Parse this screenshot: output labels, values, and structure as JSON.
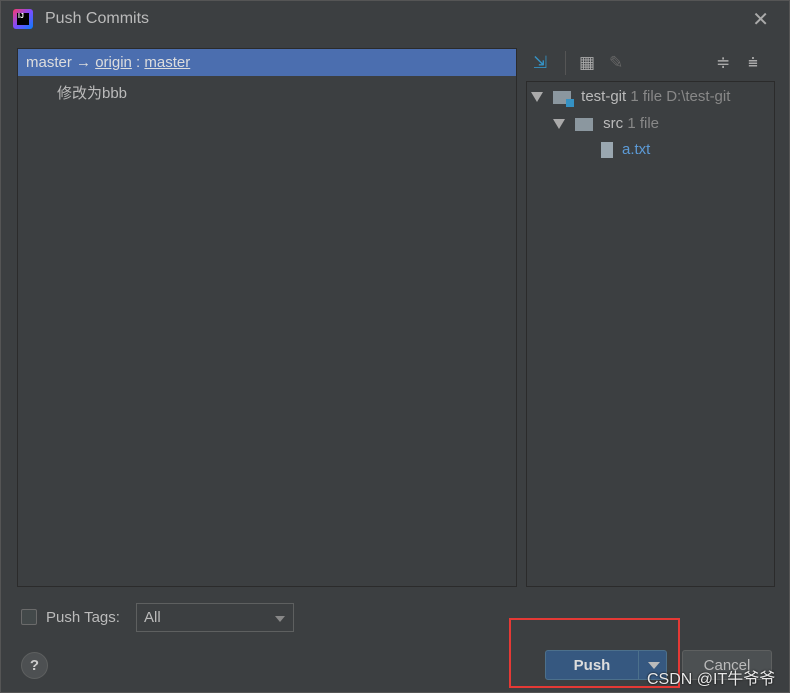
{
  "window": {
    "title": "Push Commits",
    "close_icon": "close-icon"
  },
  "commits": {
    "branch": {
      "local": "master",
      "arrow": "→",
      "remote": "origin",
      "separator": ":",
      "remote_branch": "master"
    },
    "items": [
      "修改为bbb"
    ]
  },
  "toolbar": {
    "icons": [
      "expand-arrows-icon",
      "group-by-icon",
      "edit-icon",
      "expand-all-icon",
      "collapse-all-icon"
    ]
  },
  "tree": {
    "root": {
      "name": "test-git",
      "count": "1 file",
      "path": "D:\\test-git"
    },
    "folder": {
      "name": "src",
      "count": "1 file"
    },
    "file": {
      "name": "a.txt"
    }
  },
  "footer": {
    "push_tags_label": "Push Tags:",
    "push_tags_checked": false,
    "tags_select": "All",
    "help": "?",
    "push_label": "Push",
    "cancel_label": "Cancel"
  },
  "watermark": "CSDN @IT牛爷爷",
  "colors": {
    "selection": "#4b6eaf",
    "push_button": "#365880",
    "highlight_box": "#e53935",
    "file_link": "#5c9ad6"
  }
}
